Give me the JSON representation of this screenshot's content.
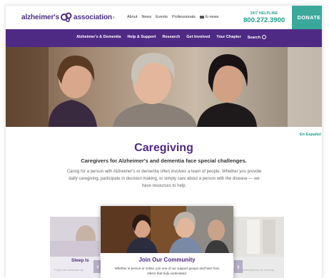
{
  "header": {
    "logo": {
      "word1": "alzheimer's",
      "word2": "association",
      "tm": "®"
    },
    "utility_nav": [
      "About",
      "News",
      "Events",
      "Professionals",
      "E-news"
    ],
    "helpline": {
      "label": "24/7 HELPLINE",
      "number": "800.272.3900"
    },
    "donate_label": "DONATE"
  },
  "main_nav": {
    "items": [
      "Alzheimer's & Dementia",
      "Help & Support",
      "Research",
      "Get Involved",
      "Your Chapter",
      "Search"
    ]
  },
  "page": {
    "espanol_link": "En Español",
    "title": "Caregiving",
    "subtitle": "Caregivers for Alzheimer's and dementia face special challenges.",
    "description": "Caring for a person with Alzheimer's or dementia often involves a team of people. Whether you provide daily caregiving, participate in decision making, or simply care about a person with the disease — we have resources to help."
  },
  "carousel": {
    "left_card_label": "Sleep Is",
    "left_card_text": "People with dementia may",
    "right_card_text": "experiencing loss the everyday",
    "center_card": {
      "title": "Join Our Community",
      "text": "Whether in person or online, join one of our support groups and hear from others that truly understand."
    }
  },
  "colors": {
    "brand_purple": "#4e2a84",
    "teal": "#1a9d8a",
    "donate_bg": "#3aa89a"
  }
}
